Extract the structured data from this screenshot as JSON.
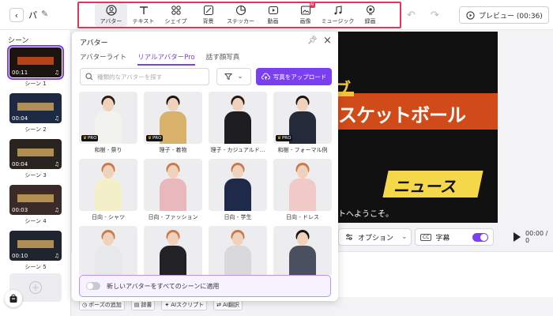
{
  "header": {
    "project_title": "パ",
    "tools": [
      {
        "label": "アバター",
        "icon": "avatar-icon",
        "active": true
      },
      {
        "label": "テキスト",
        "icon": "text-icon"
      },
      {
        "label": "シェイプ",
        "icon": "shape-icon"
      },
      {
        "label": "背景",
        "icon": "background-icon"
      },
      {
        "label": "ステッカー",
        "icon": "sticker-icon"
      },
      {
        "label": "動画",
        "icon": "video-icon"
      },
      {
        "label": "画像",
        "icon": "image-icon",
        "badge": "AI"
      },
      {
        "label": "ミュージック",
        "icon": "music-icon"
      },
      {
        "label": "録画",
        "icon": "record-icon"
      }
    ],
    "preview_label": "プレビュー (00:36)",
    "highlight_color": "#e0365a"
  },
  "scenes": {
    "title": "シーン",
    "items": [
      {
        "label": "シーン 1",
        "duration": "00:11",
        "selected": true
      },
      {
        "label": "シーン 2",
        "duration": "00:04"
      },
      {
        "label": "シーン 3",
        "duration": "00:04"
      },
      {
        "label": "シーン 4",
        "duration": "00:03"
      },
      {
        "label": "シーン 5",
        "duration": "00:10"
      }
    ]
  },
  "avatar_panel": {
    "title": "アバター",
    "tabs": [
      "アバターライト",
      "リアルアバターPro",
      "話す顔写真"
    ],
    "active_tab": 1,
    "search_placeholder": "種類的なアバターを探す",
    "upload_label": "写真をアップロード",
    "pro_label": "PRO",
    "avatars": [
      {
        "label": "和樹 - 祭り",
        "pro": true,
        "body": "#f2f2ee",
        "hair": "#2a1c14"
      },
      {
        "label": "理子 - 着物",
        "pro": true,
        "body": "#d8b16a",
        "hair": "#1d1410"
      },
      {
        "label": "理子 - カジュアルド...",
        "pro": false,
        "body": "#1e1e22",
        "hair": "#24180f"
      },
      {
        "label": "和樹 - フォーマル例",
        "pro": true,
        "body": "#252a3a",
        "hair": "#1a1410"
      },
      {
        "label": "日向 - シャツ",
        "pro": false,
        "body": "#f3efc8",
        "hair": "#c97a4a"
      },
      {
        "label": "日向 - ファッション",
        "pro": false,
        "body": "#e8b8bc",
        "hair": "#c97a4a"
      },
      {
        "label": "日向 - 学生",
        "pro": false,
        "body": "#1f2a4a",
        "hair": "#c97a4a"
      },
      {
        "label": "日向 - ドレス",
        "pro": false,
        "body": "#f2c9c9",
        "hair": "#c97a4a"
      },
      {
        "label": "",
        "pro": false,
        "body": "#e6e8ea",
        "hair": "#c97a4a"
      },
      {
        "label": "",
        "pro": false,
        "body": "#222226",
        "hair": "#c97a4a"
      },
      {
        "label": "",
        "pro": false,
        "body": "#d9d9dc",
        "hair": "#c97a4a"
      },
      {
        "label": "",
        "pro": false,
        "body": "#4a5060",
        "hair": "#1a1410"
      }
    ],
    "apply_label": "新しいアバターをすべてのシーンに適用"
  },
  "canvas": {
    "top_text": "ブ",
    "title": "スケットボール",
    "sub": "ニュース",
    "caption": "トへようこそ。"
  },
  "controls": {
    "options_label": "オプション",
    "subtitle_cc": "CC",
    "subtitle_label": "字幕",
    "time": "00:00 / 0"
  },
  "bottom_tools": [
    {
      "icon": "clock-icon",
      "label": "ポーズの追加"
    },
    {
      "icon": "dictionary-icon",
      "label": "辞書"
    },
    {
      "icon": "ai-script-icon",
      "label": "AIスクリプト"
    },
    {
      "icon": "translate-icon",
      "label": "AI翻訳"
    }
  ]
}
